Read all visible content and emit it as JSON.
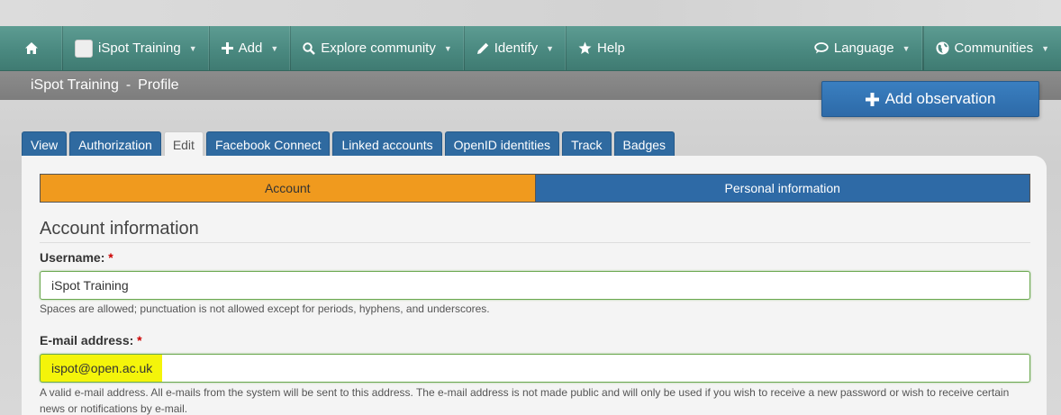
{
  "nav": {
    "home_icon": "home-icon",
    "user": "iSpot Training",
    "add": "Add",
    "explore": "Explore community",
    "identify": "Identify",
    "help": "Help",
    "language": "Language",
    "communities": "Communities"
  },
  "breadcrumb": {
    "site": "iSpot Training",
    "separator": "-",
    "page": "Profile"
  },
  "add_observation": "Add observation",
  "tabs": [
    {
      "label": "View"
    },
    {
      "label": "Authorization"
    },
    {
      "label": "Edit"
    },
    {
      "label": "Facebook Connect"
    },
    {
      "label": "Linked accounts"
    },
    {
      "label": "OpenID identities"
    },
    {
      "label": "Track"
    },
    {
      "label": "Badges"
    }
  ],
  "steps": {
    "account": "Account",
    "personal": "Personal information"
  },
  "form": {
    "section_title": "Account information",
    "username_label": "Username:",
    "username_value": "iSpot Training",
    "username_help": "Spaces are allowed; punctuation is not allowed except for periods, hyphens, and underscores.",
    "email_label": "E-mail address:",
    "email_value": "ispot@open.ac.uk",
    "email_help": "A valid e-mail address. All e-mails from the system will be sent to this address. The e-mail address is not made public and will only be used if you wish to receive a new password or wish to receive certain news or notifications by e-mail.",
    "required_mark": "*"
  },
  "colors": {
    "nav": "#4a8980",
    "step_active": "#f09a1e",
    "step_inactive": "#2e6aa6",
    "button": "#3a7fc0",
    "highlight": "#f4f40a"
  }
}
